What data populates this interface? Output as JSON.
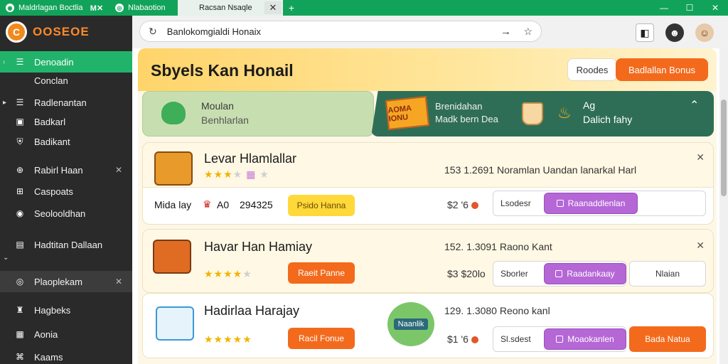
{
  "titlebar": {
    "tab1_label": "Maldrlagan Boctlia",
    "tab2_label": "M✕",
    "tab3_label": "Nlabaotion",
    "active_tab_label": "Racsan Nsaqle",
    "close_glyph": "✕",
    "new_tab_glyph": "+",
    "win_minimize": "—",
    "win_maximize": "☐",
    "win_close": "✕"
  },
  "sidebar": {
    "logo_text": "OOSEOE",
    "items": [
      {
        "label": "Denoadin",
        "sub": "Conclan"
      },
      {
        "label": "Radlenantan"
      },
      {
        "label": "Badkarl"
      },
      {
        "label": "Badikant"
      },
      {
        "label": "Rabirl Haan"
      },
      {
        "label": "Caspoats"
      },
      {
        "label": "Seolooldhan"
      },
      {
        "label": "Hadtitan Dallaan"
      },
      {
        "label": "Plaoplekam"
      },
      {
        "label": "Hagbeks"
      },
      {
        "label": "Aonia"
      },
      {
        "label": "Kaams"
      }
    ]
  },
  "toolbar": {
    "url": "Banlokomgialdi Honaix"
  },
  "main": {
    "title": "Sbyels Kan Honail",
    "btn_secondary": "Roodes",
    "btn_primary": "Badlallan Bonus",
    "banner_left": {
      "line1": "Moulan",
      "line2": "Benhlarlan"
    },
    "banner_right": {
      "badge": "AOMA IONU",
      "line1": "Brenidahan",
      "line2": "Madk bern Dea",
      "line3": "Ag",
      "line4": "Dalich fahy"
    },
    "games": [
      {
        "title": "Levar Hlamlallar",
        "rating": 3,
        "meta": "153 1.2691 Noramlan Uandan lanarkal Harl",
        "row_label": "Mida lay",
        "row_code": "A0",
        "row_num": "294325",
        "action": "Psido Hanna",
        "price": "$2 '6",
        "field": "Lsodesr",
        "purple": "Raanaddlenlan"
      },
      {
        "title": "Havar Han Hamiay",
        "rating": 4,
        "meta": "152. 1.3091 Raono Kant",
        "action": "Raeit Panne",
        "price": "$3 $20lo",
        "field": "Sborler",
        "purple": "Raadankaay",
        "extra": "Nlaian"
      },
      {
        "title": "Hadirlaa Harajay",
        "rating": 5,
        "badge": "Naanlik",
        "meta": "129. 1.3080 Reono kanl",
        "action": "Racil Fonue",
        "price": "$1 '6",
        "field": "Sl.sdest",
        "purple": "Moaokanlen",
        "action2": "Bada Natua"
      }
    ]
  },
  "colors": {
    "brand_green": "#12a35a",
    "accent_orange": "#f36a1c",
    "purple": "#b567d6",
    "sidebar_bg": "#2a2a2a"
  }
}
